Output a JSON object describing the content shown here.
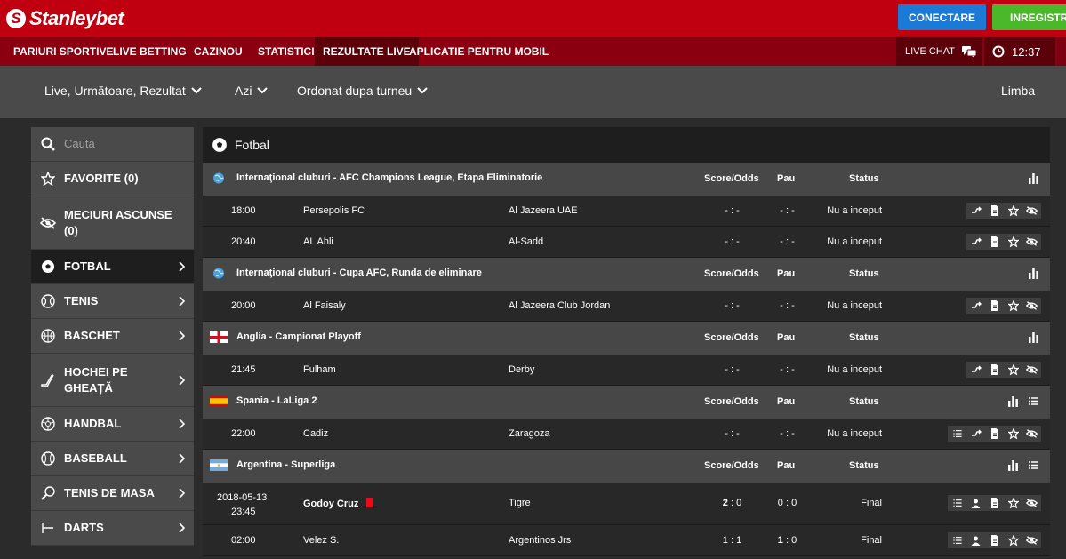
{
  "brand": {
    "name": "Stanleybet",
    "mark": "S"
  },
  "top": {
    "connect": "CONECTARE",
    "register": "INREGISTRARE"
  },
  "nav": {
    "items": [
      "PARIURI SPORTIVE",
      "LIVE BETTING",
      "CAZINOU",
      "STATISTICI",
      "REZULTATE LIVE",
      "APLICATIE PENTRU MOBIL"
    ],
    "active_index": 4,
    "live_chat": "LIVE CHAT",
    "time": "12:37"
  },
  "filters": {
    "mode": "Live, Următoare, Rezultat",
    "day": "Azi",
    "order": "Ordonat dupa turneu",
    "language": "Limba"
  },
  "sidebar": {
    "search_placeholder": "Cauta",
    "items": [
      {
        "label": "FAVORITE (0)",
        "icon": "star-icon"
      },
      {
        "label": "MECIURI ASCUNSE (0)",
        "icon": "eye-off-icon"
      },
      {
        "label": "FOTBAL",
        "icon": "soccer-ball-icon"
      },
      {
        "label": "TENIS",
        "icon": "tennis-ball-icon"
      },
      {
        "label": "BASCHET",
        "icon": "basketball-icon"
      },
      {
        "label": "HOCHEI PE GHEAȚĂ",
        "icon": "hockey-stick-icon"
      },
      {
        "label": "HANDBAL",
        "icon": "handball-icon"
      },
      {
        "label": "BASEBALL",
        "icon": "baseball-icon"
      },
      {
        "label": "TENIS DE MASA",
        "icon": "table-tennis-icon"
      },
      {
        "label": "DARTS",
        "icon": "darts-icon"
      }
    ],
    "selected": "FOTBAL"
  },
  "main": {
    "sport": "Fotbal",
    "headers": {
      "score": "Score/Odds",
      "pau": "Pau",
      "status": "Status"
    },
    "leagues": [
      {
        "name": "Internaţional cluburi - AFC Champions League, Etapa Eliminatorie",
        "flag": "world",
        "matches": [
          {
            "time": "18:00",
            "home": "Persepolis FC",
            "away": "Al Jazeera UAE",
            "score": "- : -",
            "pau": "- : -",
            "status": "Nu a inceput"
          },
          {
            "time": "20:40",
            "home": "AL Ahli",
            "away": "Al-Sadd",
            "score": "- : -",
            "pau": "- : -",
            "status": "Nu a inceput"
          }
        ]
      },
      {
        "name": "Internaţional cluburi - Cupa AFC, Runda de eliminare",
        "flag": "world",
        "matches": [
          {
            "time": "20:00",
            "home": "Al Faisaly",
            "away": "Al Jazeera Club Jordan",
            "score": "- : -",
            "pau": "- : -",
            "status": "Nu a inceput"
          }
        ]
      },
      {
        "name": "Anglia - Campionat Playoff",
        "flag": "england",
        "matches": [
          {
            "time": "21:45",
            "home": "Fulham",
            "away": "Derby",
            "score": "- : -",
            "pau": "- : -",
            "status": "Nu a inceput"
          }
        ]
      },
      {
        "name": "Spania - LaLiga 2",
        "flag": "spain",
        "matches": [
          {
            "time": "22:00",
            "home": "Cadiz",
            "away": "Zaragoza",
            "score": "- : -",
            "pau": "- : -",
            "status": "Nu a inceput"
          }
        ]
      },
      {
        "name": "Argentina - Superliga",
        "flag": "argentina",
        "matches": [
          {
            "date": "2018-05-13",
            "time": "23:45",
            "home": "Godoy Cruz",
            "away": "Tigre",
            "score_home": "2",
            "score_away": "0",
            "pau": "0 : 0",
            "status": "Final"
          },
          {
            "time": "02:00",
            "home": "Velez S.",
            "away": "Argentinos Jrs",
            "score": "1 : 1",
            "pau_home": "1",
            "pau_away": "0",
            "status": "Final"
          }
        ]
      }
    ]
  },
  "colors": {
    "brand_red": "#c00010",
    "nav_red": "#8a0010",
    "connect_blue": "#1a7ad6",
    "register_green": "#4ab82a",
    "red_card": "#e0101e"
  }
}
